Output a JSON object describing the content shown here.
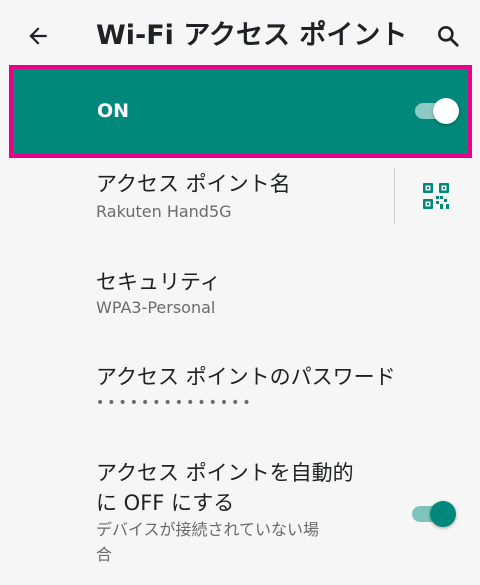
{
  "appbar": {
    "title": "Wi-Fi アクセス ポイント",
    "back_icon": "arrow-back-icon",
    "search_icon": "search-icon"
  },
  "master_switch": {
    "label": "ON",
    "state": "on",
    "bar_color": "#00897b",
    "highlight_color": "#e9008a"
  },
  "prefs": {
    "ap_name": {
      "title": "アクセス ポイント名",
      "summary": "Rakuten Hand5G",
      "action_icon": "qr-code-icon"
    },
    "security": {
      "title": "セキュリティ",
      "summary": "WPA3-Personal"
    },
    "password": {
      "title": "アクセス ポイントのパスワード",
      "masked": "••••••••••••••"
    },
    "auto_off": {
      "title_line1": "アクセス ポイントを自動的",
      "title_line2": "に OFF にする",
      "summary_line1": "デバイスが接続されていない場",
      "summary_line2": "合",
      "state": "on"
    }
  }
}
